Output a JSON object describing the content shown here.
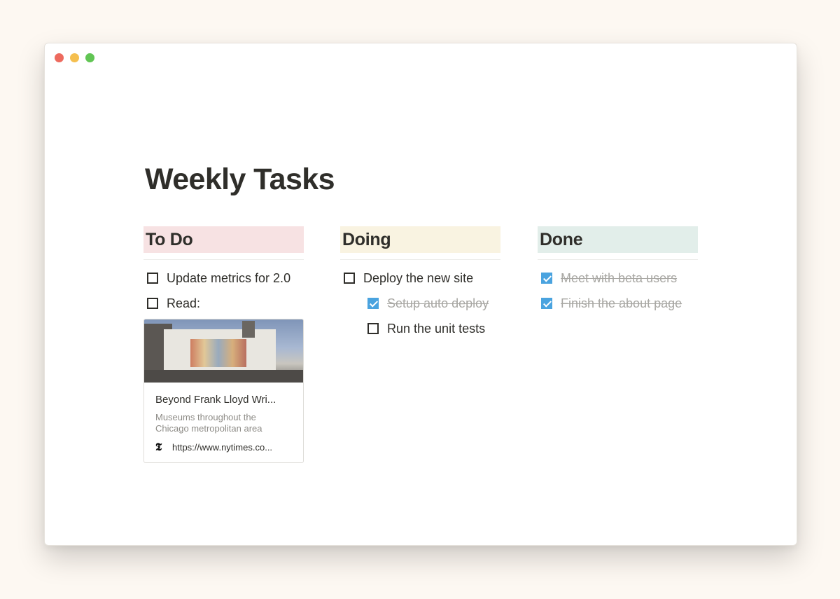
{
  "page": {
    "title": "Weekly Tasks"
  },
  "columns": {
    "todo": {
      "header": "To Do",
      "header_color": "#f7e2e3",
      "tasks": [
        {
          "label": "Update metrics for 2.0",
          "checked": false
        },
        {
          "label": "Read:",
          "checked": false
        }
      ],
      "bookmark": {
        "title": "Beyond Frank Lloyd Wri...",
        "description": "Museums throughout the Chicago metropolitan area",
        "url": "https://www.nytimes.co...",
        "icon": "nyt-logo-icon",
        "icon_glyph": "𝕿"
      }
    },
    "doing": {
      "header": "Doing",
      "header_color": "#f9f3e1",
      "tasks": [
        {
          "label": "Deploy the new site",
          "checked": false
        },
        {
          "label": "Setup auto deploy",
          "checked": true
        },
        {
          "label": "Run the unit tests",
          "checked": false
        }
      ]
    },
    "done": {
      "header": "Done",
      "header_color": "#e2eeea",
      "tasks": [
        {
          "label": "Meet with beta users",
          "checked": true
        },
        {
          "label": "Finish the about page",
          "checked": true
        }
      ]
    }
  },
  "colors": {
    "checkbox_checked": "#4aa3df",
    "window_background": "#ffffff",
    "page_background": "#fdf8f2"
  }
}
